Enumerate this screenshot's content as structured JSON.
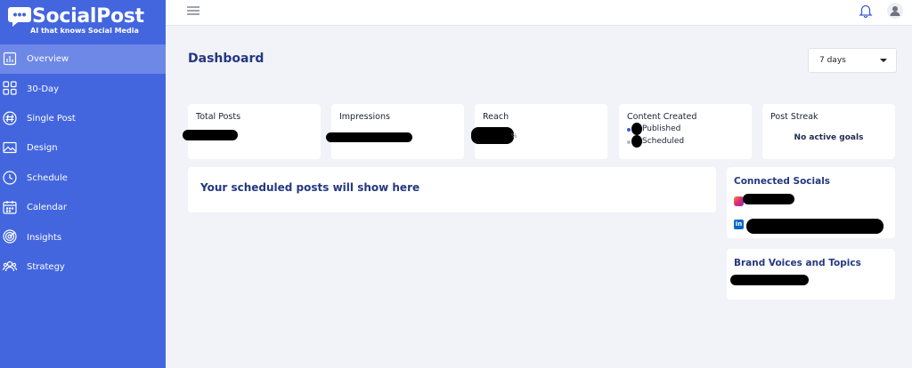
{
  "brand": {
    "title": "SocialPost",
    "subtitle": "AI that knows Social Media",
    "accent": "#4366df"
  },
  "sidebar": {
    "items": [
      {
        "label": "Overview",
        "icon": "bar-chart-icon",
        "active": true
      },
      {
        "label": "30-Day",
        "icon": "grid-icon",
        "active": false
      },
      {
        "label": "Single Post",
        "icon": "hashtag-icon",
        "active": false
      },
      {
        "label": "Design",
        "icon": "image-icon",
        "active": false
      },
      {
        "label": "Schedule",
        "icon": "clock-icon",
        "active": false
      },
      {
        "label": "Calendar",
        "icon": "calendar-icon",
        "active": false
      },
      {
        "label": "Insights",
        "icon": "insights-icon",
        "active": false
      },
      {
        "label": "Strategy",
        "icon": "users-icon",
        "active": false
      }
    ]
  },
  "header": {
    "title": "Dashboard",
    "range": {
      "selected": "7 days"
    }
  },
  "stats": {
    "total_posts": {
      "label": "Total Posts"
    },
    "impressions": {
      "label": "Impressions"
    },
    "reach": {
      "label": "Reach",
      "suffix": "%"
    },
    "content_created": {
      "label": "Content Created",
      "published_label": "Published",
      "scheduled_label": "Scheduled",
      "published_color": "#3b5bdb",
      "scheduled_color": "#b0b6c3"
    },
    "post_streak": {
      "label": "Post Streak",
      "message": "No active goals"
    }
  },
  "scheduled": {
    "message": "Your scheduled posts will show here"
  },
  "connected": {
    "title": "Connected Socials",
    "icons": [
      "instagram-icon",
      "linkedin-icon"
    ],
    "linkedin_glyph": "in"
  },
  "brand_voices": {
    "title": "Brand Voices and Topics"
  }
}
